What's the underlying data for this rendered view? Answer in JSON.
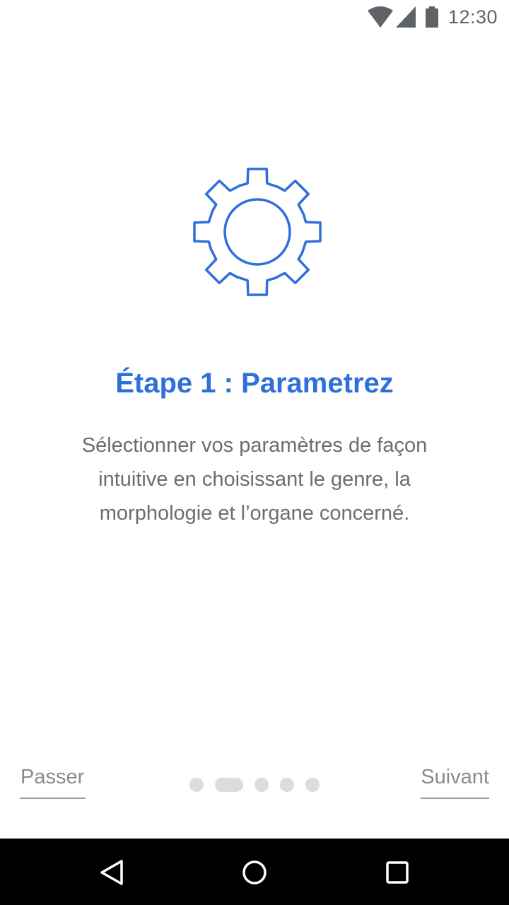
{
  "status_bar": {
    "time": "12:30",
    "icons": [
      "wifi-icon",
      "cell-signal-icon",
      "battery-icon"
    ]
  },
  "onboarding": {
    "illustration": "gear-icon",
    "title": "Étape 1 : Parametrez",
    "description": "Sélectionner vos paramètres de façon intuitive en choisissant le genre, la morphologie et l’organe concerné.",
    "skip_label": "Passer",
    "next_label": "Suivant",
    "page_indicator": {
      "total": 5,
      "active_index": 1
    }
  },
  "navigation_bar": {
    "buttons": [
      "back-icon",
      "home-icon",
      "recents-icon"
    ]
  },
  "colors": {
    "accent": "#2f6fdc",
    "body_text": "#6d6d6d",
    "muted_text": "#8a8a8a",
    "dot_inactive": "#dcdcdc",
    "nav_bar": "#000000"
  }
}
